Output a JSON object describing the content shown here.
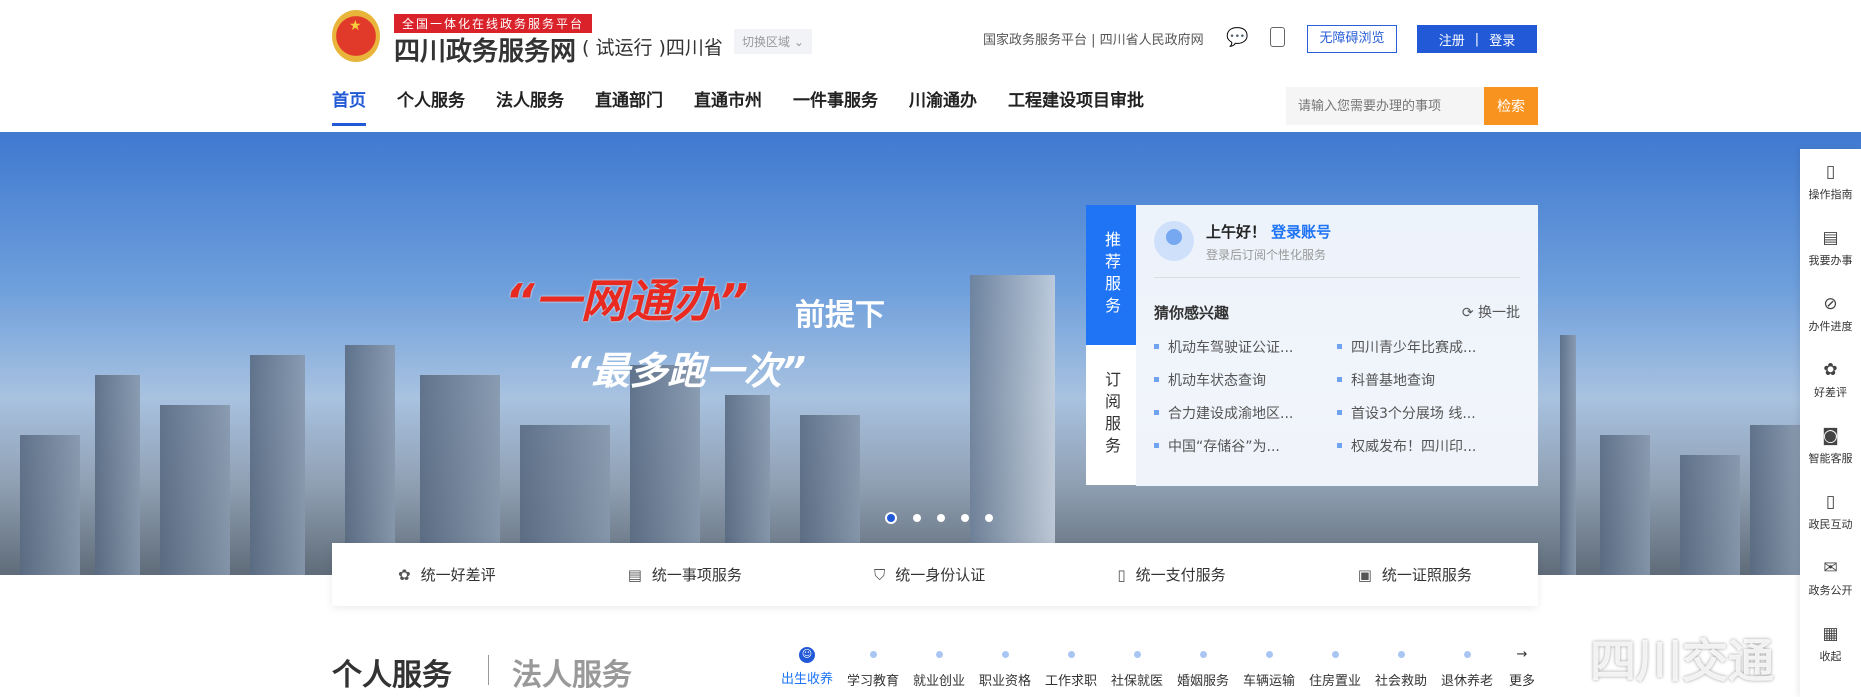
{
  "header": {
    "platform_tag": "全国一体化在线政务服务平台",
    "site_title": "四川政务服务网",
    "trial": "( 试运行 )四川省",
    "region_switch": "切换区域 ⌄",
    "top_links": "国家政务服务平台 | 四川省人民政府网",
    "accessible": "无障碍浏览",
    "register": "注册",
    "login": "登录"
  },
  "nav": [
    "首页",
    "个人服务",
    "法人服务",
    "直通部门",
    "直通市州",
    "一件事服务",
    "川渝通办",
    "工程建设项目审批"
  ],
  "search": {
    "placeholder": "请输入您需要办理的事项",
    "button": "检索"
  },
  "banner": {
    "slogan1": "“一网通办”",
    "slogan1b": "前提下",
    "slogan2": "“最多跑一次”"
  },
  "panel": {
    "tab1": "推荐服务",
    "tab2": "订阅服务",
    "greeting": "上午好！",
    "login_link": "登录账号",
    "subtitle": "登录后订阅个性化服务",
    "guess": "猜你感兴趣",
    "refresh": "换一批",
    "items": [
      "机动车驾驶证公证...",
      "四川青少年比赛成...",
      "机动车状态查询",
      "科普基地查询",
      "合力建设成渝地区...",
      "首设3个分展场 线...",
      "中国“存储谷”为...",
      "权威发布！四川印..."
    ]
  },
  "services": [
    "统一好差评",
    "统一事项服务",
    "统一身份认证",
    "统一支付服务",
    "统一证照服务"
  ],
  "sidebar": [
    "操作指南",
    "我要办事",
    "办件进度",
    "好差评",
    "智能客服",
    "政民互动",
    "政务公开",
    "收起"
  ],
  "section": {
    "personal": "个人服务",
    "legal": "法人服务",
    "categories": [
      "出生收养",
      "学习教育",
      "就业创业",
      "职业资格",
      "工作求职",
      "社保就医",
      "婚姻服务",
      "车辆运输",
      "住房置业",
      "社会救助",
      "退休养老",
      "更多"
    ]
  },
  "watermark": "四川交通"
}
